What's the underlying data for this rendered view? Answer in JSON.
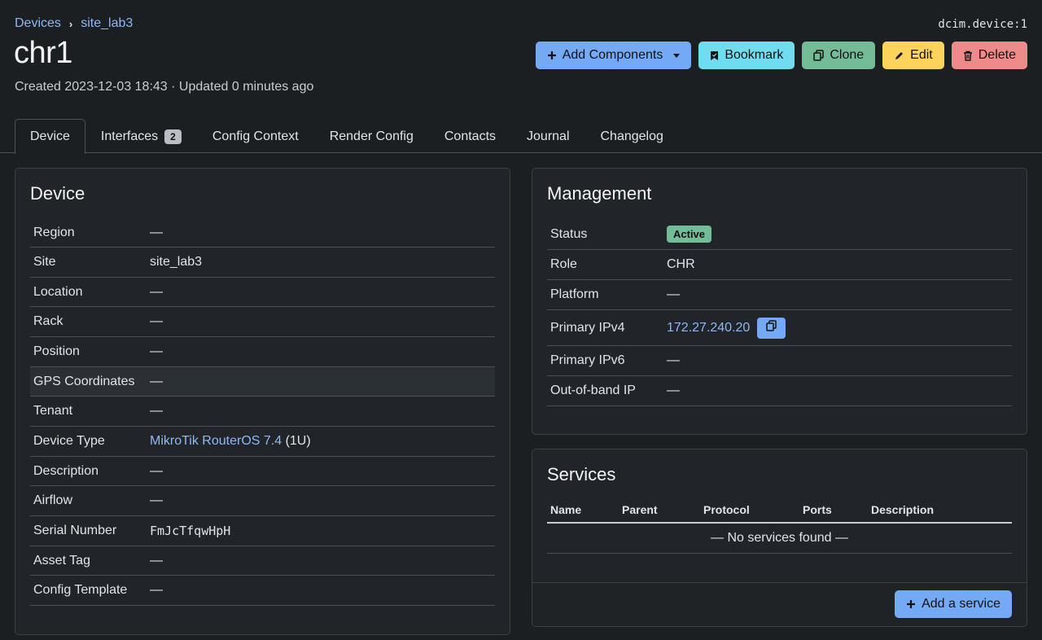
{
  "breadcrumb": {
    "root": "Devices",
    "site": "site_lab3"
  },
  "object_id": "dcim.device:1",
  "title": "chr1",
  "meta": "Created 2023-12-03 18:43 · Updated 0 minutes ago",
  "actions": {
    "add_components": "Add Components",
    "bookmark": "Bookmark",
    "clone": "Clone",
    "edit": "Edit",
    "delete": "Delete"
  },
  "tabs": {
    "device": "Device",
    "interfaces": "Interfaces",
    "interfaces_count": "2",
    "config_context": "Config Context",
    "render_config": "Render Config",
    "contacts": "Contacts",
    "journal": "Journal",
    "changelog": "Changelog"
  },
  "device_card": {
    "title": "Device",
    "region": {
      "label": "Region",
      "value": "—"
    },
    "site": {
      "label": "Site",
      "value": "site_lab3"
    },
    "location": {
      "label": "Location",
      "value": "—"
    },
    "rack": {
      "label": "Rack",
      "value": "—"
    },
    "position": {
      "label": "Position",
      "value": "—"
    },
    "gps": {
      "label": "GPS Coordinates",
      "value": "—"
    },
    "tenant": {
      "label": "Tenant",
      "value": "—"
    },
    "device_type": {
      "label": "Device Type",
      "value": "MikroTik RouterOS 7.4",
      "suffix": "(1U)"
    },
    "description": {
      "label": "Description",
      "value": "—"
    },
    "airflow": {
      "label": "Airflow",
      "value": "—"
    },
    "serial": {
      "label": "Serial Number",
      "value": "FmJcTfqwHpH"
    },
    "asset_tag": {
      "label": "Asset Tag",
      "value": "—"
    },
    "config_template": {
      "label": "Config Template",
      "value": "—"
    }
  },
  "management_card": {
    "title": "Management",
    "status": {
      "label": "Status",
      "value": "Active"
    },
    "role": {
      "label": "Role",
      "value": "CHR"
    },
    "platform": {
      "label": "Platform",
      "value": "—"
    },
    "ipv4": {
      "label": "Primary IPv4",
      "value": "172.27.240.20"
    },
    "ipv6": {
      "label": "Primary IPv6",
      "value": "—"
    },
    "oob": {
      "label": "Out-of-band IP",
      "value": "—"
    }
  },
  "services_card": {
    "title": "Services",
    "columns": [
      "Name",
      "Parent",
      "Protocol",
      "Ports",
      "Description"
    ],
    "empty": "— No services found —",
    "add_button": "Add a service"
  },
  "colors": {
    "background": "#1b1f22",
    "card": "#212529",
    "link": "#8fb8f5",
    "primary": "#74a9f6",
    "success": "#74bb98",
    "info": "#6fdcef",
    "warning": "#fdd35c",
    "danger": "#ef8a8a"
  }
}
